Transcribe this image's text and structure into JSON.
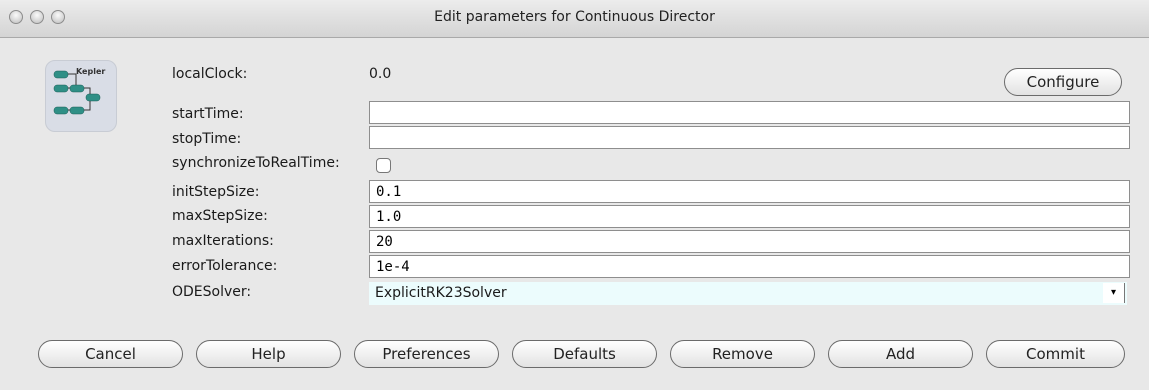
{
  "window": {
    "title": "Edit parameters for Continuous Director"
  },
  "logo": {
    "text": "Kepler"
  },
  "params": {
    "localClock": {
      "label": "localClock:",
      "value": "0.0"
    },
    "startTime": {
      "label": "startTime:",
      "value": ""
    },
    "stopTime": {
      "label": "stopTime:",
      "value": ""
    },
    "synchronizeToRealTime": {
      "label": "synchronizeToRealTime:",
      "checked": false
    },
    "initStepSize": {
      "label": "initStepSize:",
      "value": "0.1"
    },
    "maxStepSize": {
      "label": "maxStepSize:",
      "value": "1.0"
    },
    "maxIterations": {
      "label": "maxIterations:",
      "value": "20"
    },
    "errorTolerance": {
      "label": "errorTolerance:",
      "value": "1e-4"
    },
    "ODESolver": {
      "label": "ODESolver:",
      "value": "ExplicitRK23Solver"
    }
  },
  "buttons": {
    "configure": "Configure",
    "cancel": "Cancel",
    "help": "Help",
    "preferences": "Preferences",
    "defaults": "Defaults",
    "remove": "Remove",
    "add": "Add",
    "commit": "Commit"
  },
  "icons": {
    "dropdown_arrow": "▾"
  }
}
